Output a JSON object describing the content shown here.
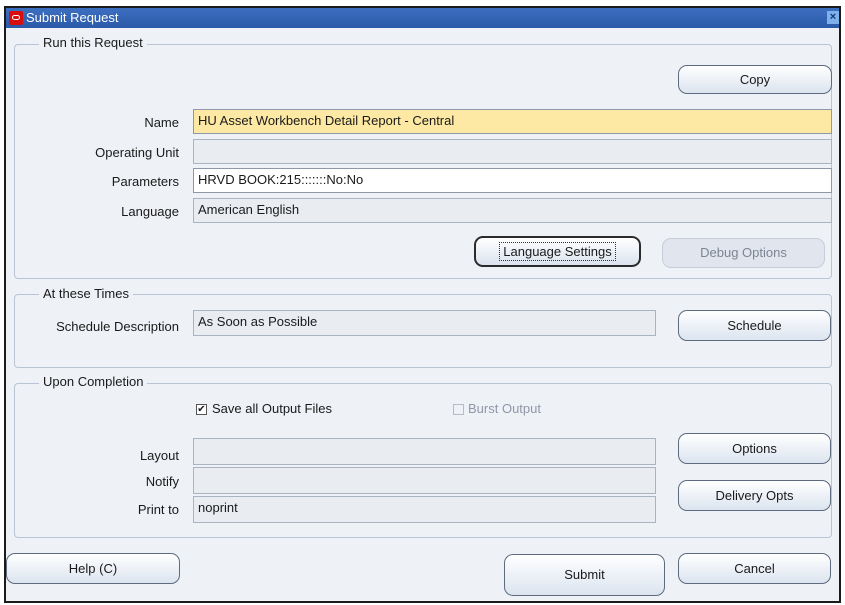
{
  "window": {
    "title": "Submit Request",
    "close_glyph": "×"
  },
  "run": {
    "group_title": "Run this Request",
    "copy_label": "Copy",
    "name_label": "Name",
    "name_value": "HU Asset Workbench Detail Report - Central",
    "operating_unit_label": "Operating Unit",
    "operating_unit_value": "",
    "parameters_label": "Parameters",
    "parameters_value": "HRVD BOOK:215:::::::No:No",
    "language_label": "Language",
    "language_value": "American English",
    "language_settings_label": "Language Settings",
    "debug_options_label": "Debug Options"
  },
  "times": {
    "group_title": "At these Times",
    "schedule_description_label": "Schedule Description",
    "schedule_description_value": "As Soon as Possible",
    "schedule_label": "Schedule"
  },
  "completion": {
    "group_title": "Upon Completion",
    "save_output_label": "Save all Output Files",
    "save_output_checked": true,
    "burst_output_label": "Burst Output",
    "burst_output_checked": false,
    "layout_label": "Layout",
    "layout_value": "",
    "notify_label": "Notify",
    "notify_value": "",
    "print_to_label": "Print to",
    "print_to_value": "noprint",
    "options_label": "Options",
    "delivery_opts_label": "Delivery Opts"
  },
  "footer": {
    "help_label": "Help (C)",
    "submit_label": "Submit",
    "cancel_label": "Cancel"
  },
  "colors": {
    "titlebar": "#2a5aa8",
    "name_field_bg": "#fde9a3",
    "dialog_bg": "#eef1f6"
  }
}
